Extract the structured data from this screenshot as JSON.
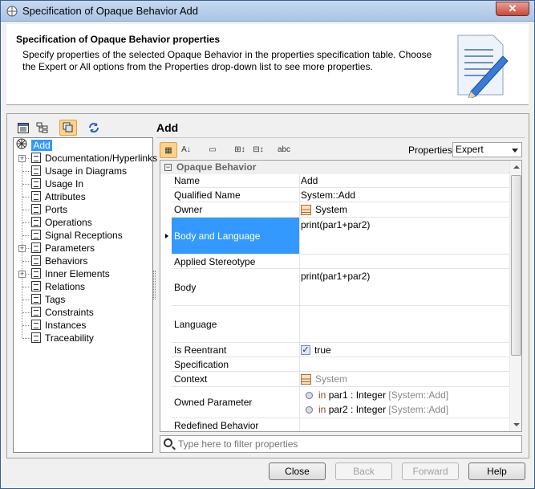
{
  "window": {
    "title": "Specification of Opaque Behavior Add",
    "close_glyph": "✕"
  },
  "header": {
    "title": "Specification of Opaque Behavior properties",
    "description": "Specify properties of the selected Opaque Behavior in the properties specification table. Choose the Expert or All options from the Properties drop-down list to see more properties."
  },
  "tree": {
    "root": "Add",
    "items": [
      {
        "label": "Documentation/Hyperlinks",
        "expandable": true
      },
      {
        "label": "Usage in Diagrams",
        "expandable": false
      },
      {
        "label": "Usage In",
        "expandable": false
      },
      {
        "label": "Attributes",
        "expandable": false
      },
      {
        "label": "Ports",
        "expandable": false
      },
      {
        "label": "Operations",
        "expandable": false
      },
      {
        "label": "Signal Receptions",
        "expandable": false
      },
      {
        "label": "Parameters",
        "expandable": true
      },
      {
        "label": "Behaviors",
        "expandable": false
      },
      {
        "label": "Inner Elements",
        "expandable": true
      },
      {
        "label": "Relations",
        "expandable": false
      },
      {
        "label": "Tags",
        "expandable": false
      },
      {
        "label": "Constraints",
        "expandable": false
      },
      {
        "label": "Instances",
        "expandable": false
      },
      {
        "label": "Traceability",
        "expandable": false
      }
    ]
  },
  "main": {
    "title": "Add",
    "properties_label": "Properties:",
    "properties_value": "Expert",
    "group": "Opaque Behavior",
    "rows": {
      "name": {
        "k": "Name",
        "v": "Add"
      },
      "qname": {
        "k": "Qualified Name",
        "v": "System::Add"
      },
      "owner": {
        "k": "Owner",
        "v": "System"
      },
      "bodylang": {
        "k": "Body and Language",
        "v": "print(par1+par2)"
      },
      "stereo": {
        "k": "Applied Stereotype",
        "v": ""
      },
      "body": {
        "k": "Body",
        "v": "print(par1+par2)"
      },
      "language": {
        "k": "Language",
        "v": ""
      },
      "reentrant": {
        "k": "Is Reentrant",
        "v": "true",
        "checked": true
      },
      "spec": {
        "k": "Specification",
        "v": ""
      },
      "context": {
        "k": "Context",
        "v": "System"
      },
      "params": {
        "k": "Owned Parameter",
        "p1": {
          "dir": "in",
          "name": "par1 : Integer",
          "owner": "[System::Add]"
        },
        "p2": {
          "dir": "in",
          "name": "par2 : Integer",
          "owner": "[System::Add]"
        }
      },
      "redef": {
        "k": "Redefined Behavior",
        "v": ""
      }
    },
    "filter_placeholder": "Type here to filter properties"
  },
  "buttons": {
    "close": "Close",
    "back": "Back",
    "forward": "Forward",
    "help": "Help"
  },
  "colors": {
    "selection": "#3399ff",
    "active_tool": "#fbd38a"
  }
}
